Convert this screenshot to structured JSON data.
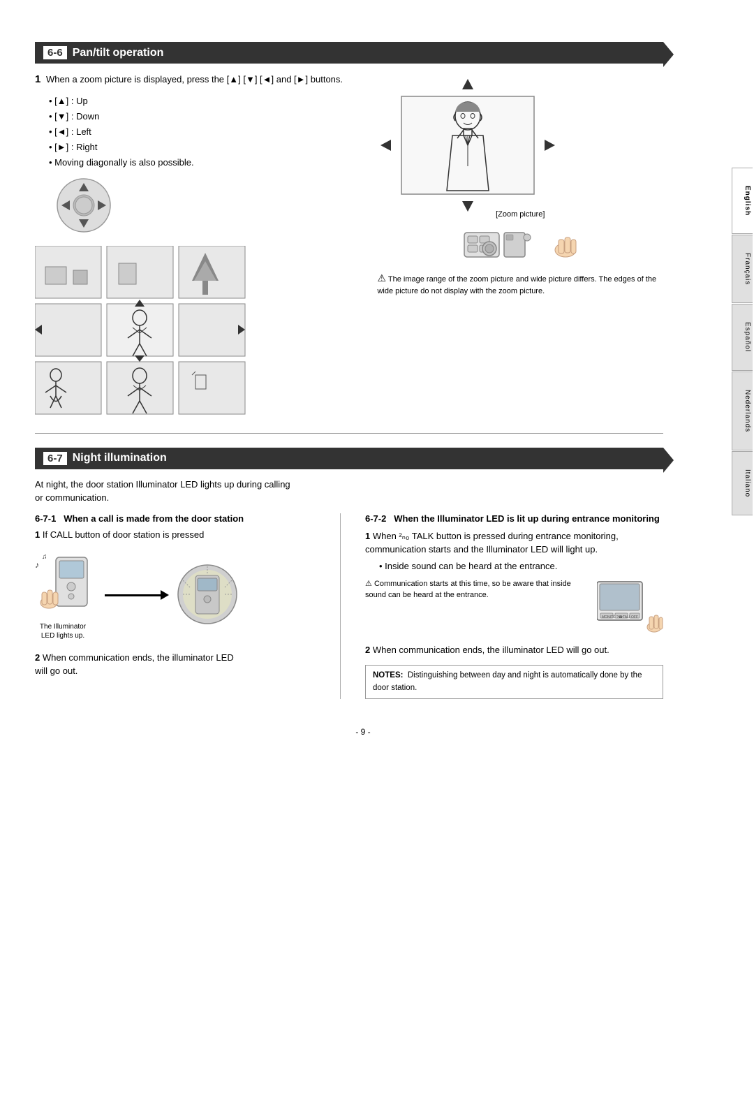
{
  "page": {
    "number": "- 9 -",
    "sidebar_tabs": [
      "English",
      "Français",
      "Español",
      "Nederlands",
      "Italiano"
    ],
    "active_tab": "English"
  },
  "section_66": {
    "header_number": "6-6",
    "header_title": "Pan/tilt operation",
    "step1_text": "When a zoom picture is displayed, press the [▲] [▼] [◄] and [►] buttons.",
    "bullets": [
      "[▲] : Up",
      "[▼] : Down",
      "[◄] : Left",
      "[►] : Right",
      "Moving diagonally is also possible."
    ],
    "zoom_picture_label": "[Zoom picture]",
    "warning_text": "The image range of the zoom picture and wide picture differs. The edges of the wide picture do not display with the zoom picture."
  },
  "section_67": {
    "header_number": "6-7",
    "header_title": "Night illumination",
    "intro_text": "At night, the door station Illuminator LED lights up during calling or communication.",
    "subsection_671": {
      "number": "6-7-1",
      "title": "When a call is made from the door station",
      "step1": "If CALL button of door station is pressed",
      "illuminator_label": "The Illuminator LED lights up.",
      "step2": "When communication ends, the illuminator LED will go out."
    },
    "subsection_672": {
      "number": "6-7-2",
      "title": "When the Illuminator LED is lit up during entrance monitoring",
      "step1_text": "When ²ₙ₀ TALK button is pressed during entrance monitoring, communication starts and the Illuminator LED will light up.",
      "step1_bullet": "Inside sound can be heard at the entrance.",
      "warning_text": "Communication starts at this time, so be aware that inside sound can be heard at the entrance.",
      "step2": "When communication ends, the illuminator LED will go out.",
      "notes_label": "NOTES:",
      "notes_text": "Distinguishing between day and night is automatically done by the door station."
    }
  }
}
